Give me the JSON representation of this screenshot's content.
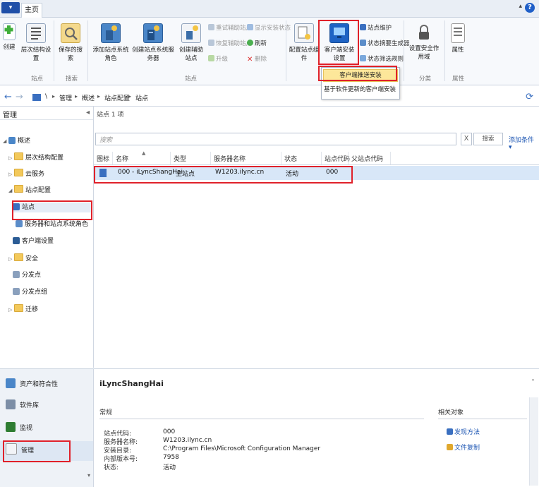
{
  "titlebar": {
    "file_label": "▾",
    "home_tab": "主页",
    "minimize_ribbon": "▴",
    "help": "?"
  },
  "ribbon": {
    "create": "创建",
    "hierarchy_settings": "层次结构设置",
    "saved_searches": "保存的搜索",
    "add_role": "添加站点系统角色",
    "create_server": "创建站点系统服务器",
    "create_secondary": "创建辅助站点",
    "retry_secondary": "重试辅助站点",
    "show_install_status": "显示安装状态",
    "recover_secondary": "恢复辅助站点",
    "refresh": "刷新",
    "upgrade": "升级",
    "delete": "删除",
    "configure_components": "配置站点组件",
    "client_install_settings": "客户端安装设置",
    "site_maintenance": "站点维护",
    "status_summary": "状态摘要生成器",
    "status_filter": "状态筛选规则",
    "security_scopes": "设置安全作用域",
    "properties": "属性",
    "group_site": "站点",
    "group_search": "搜索",
    "group_site2": "站点",
    "group_classify": "分类",
    "group_props": "属性"
  },
  "dropdown": {
    "items": [
      "客户端推送安装",
      "基于软件更新的客户端安装"
    ]
  },
  "addressbar": {
    "back": "←",
    "forward": "→",
    "crumbs": [
      "\\",
      "管理",
      "概述",
      "站点配置",
      "站点"
    ],
    "refresh": "⟳"
  },
  "left_pane": {
    "header": "管理",
    "collapse": "◂",
    "tree": [
      {
        "label": "概述",
        "level": 0
      },
      {
        "label": "层次结构配置",
        "level": 1
      },
      {
        "label": "云服务",
        "level": 1
      },
      {
        "label": "站点配置",
        "level": 1
      },
      {
        "label": "站点",
        "level": 2
      },
      {
        "label": "服务器和站点系统角色",
        "level": 2
      },
      {
        "label": "客户端设置",
        "level": 1
      },
      {
        "label": "安全",
        "level": 1
      },
      {
        "label": "分发点",
        "level": 1
      },
      {
        "label": "分发点组",
        "level": 1
      },
      {
        "label": "迁移",
        "level": 1
      }
    ]
  },
  "workspaces": [
    "资产和符合性",
    "软件库",
    "监视",
    "管理"
  ],
  "main": {
    "count_label": "站点 1 项",
    "search_placeholder": "搜索",
    "search_clear": "X",
    "search_button": "搜索",
    "add_criteria": "添加条件 ▾",
    "columns": [
      "图标",
      "名称",
      "类型",
      "服务器名称",
      "状态",
      "站点代码",
      "父站点代码"
    ],
    "rows": [
      {
        "name": "000 - iLyncShangHai",
        "type": "主站点",
        "server": "W1203.ilync.cn",
        "status": "活动",
        "code": "000",
        "parent": ""
      }
    ]
  },
  "details": {
    "title": "iLyncShangHai",
    "section": "常规",
    "fields": [
      {
        "k": "站点代码:",
        "v": "000"
      },
      {
        "k": "服务器名称:",
        "v": "W1203.ilync.cn"
      },
      {
        "k": "安装目录:",
        "v": "C:\\Program Files\\Microsoft Configuration Manager"
      },
      {
        "k": "内部版本号:",
        "v": "7958"
      },
      {
        "k": "状态:",
        "v": "活动"
      }
    ],
    "related_title": "相关对象",
    "related": [
      "发现方法",
      "文件复制"
    ],
    "collapse": "˅"
  },
  "colors": {
    "accent": "#1f5fc8",
    "highlight": "#e0212a",
    "selection": "#d8e7f8",
    "menu_hover": "#fde79a"
  },
  "icons": [
    "create-icon",
    "hierarchy-icon",
    "saved-search-icon",
    "add-role-icon",
    "server-icon",
    "secondary-site-icon",
    "client-install-icon",
    "lock-icon",
    "properties-icon"
  ]
}
